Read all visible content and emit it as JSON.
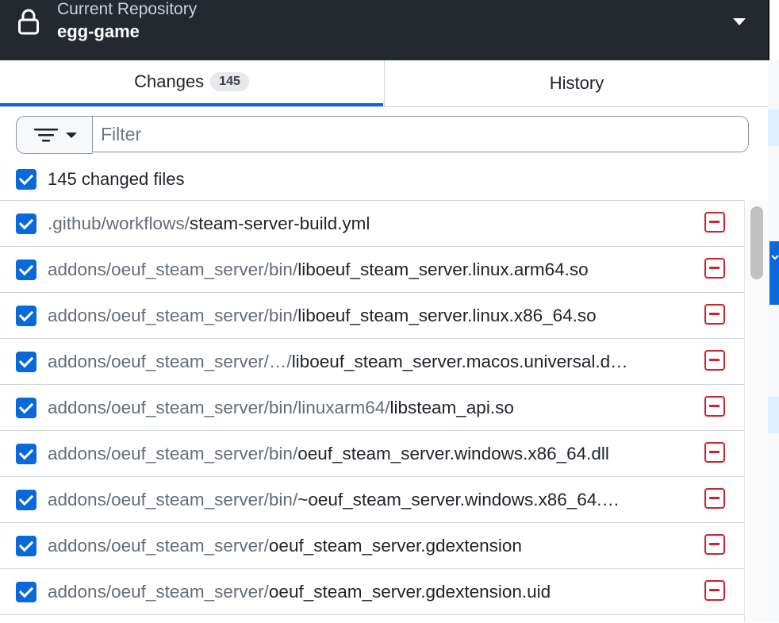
{
  "header": {
    "caption": "Current Repository",
    "repo_name": "egg-game",
    "lock_icon": "lock-icon",
    "caret_icon": "triangle-down-icon"
  },
  "tabs": {
    "changes_label": "Changes",
    "changes_count": "145",
    "history_label": "History",
    "active": "changes"
  },
  "filter": {
    "placeholder": "Filter",
    "value": "",
    "button_icon": "filter-lines-icon"
  },
  "summary": {
    "label": "145 changed files",
    "all_checked": true
  },
  "files": [
    {
      "dir": ".github/workflows/",
      "name": "steam-server-build.yml",
      "checked": true,
      "status": "deleted"
    },
    {
      "dir": "addons/oeuf_steam_server/bin/",
      "name": "liboeuf_steam_server.linux.arm64.so",
      "checked": true,
      "status": "deleted"
    },
    {
      "dir": "addons/oeuf_steam_server/bin/",
      "name": "liboeuf_steam_server.linux.x86_64.so",
      "checked": true,
      "status": "deleted"
    },
    {
      "dir": "addons/oeuf_steam_server/…/",
      "name": "liboeuf_steam_server.macos.universal.d…",
      "checked": true,
      "status": "deleted"
    },
    {
      "dir": "addons/oeuf_steam_server/bin/linuxarm64/",
      "name": "libsteam_api.so",
      "checked": true,
      "status": "deleted"
    },
    {
      "dir": "addons/oeuf_steam_server/bin/",
      "name": "oeuf_steam_server.windows.x86_64.dll",
      "checked": true,
      "status": "deleted"
    },
    {
      "dir": "addons/oeuf_steam_server/bin/",
      "name": "~oeuf_steam_server.windows.x86_64.…",
      "checked": true,
      "status": "deleted"
    },
    {
      "dir": "addons/oeuf_steam_server/",
      "name": "oeuf_steam_server.gdextension",
      "checked": true,
      "status": "deleted"
    },
    {
      "dir": "addons/oeuf_steam_server/",
      "name": "oeuf_steam_server.gdextension.uid",
      "checked": true,
      "status": "deleted"
    }
  ],
  "colors": {
    "header_bg": "#24292f",
    "accent": "#0969da",
    "deleted": "#cf222e"
  }
}
